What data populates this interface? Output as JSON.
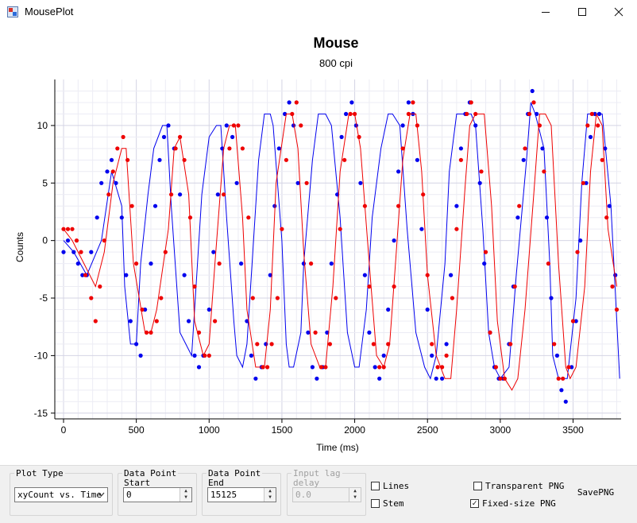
{
  "window": {
    "title": "MousePlot",
    "minimize_icon": "minimize-icon",
    "maximize_icon": "maximize-icon",
    "close_icon": "close-icon"
  },
  "colors": {
    "blue": "#0000ee",
    "red": "#ee0000",
    "grid": "#e4e4ee",
    "axis": "#000000"
  },
  "chart_data": {
    "type": "scatter",
    "title": "Mouse",
    "subtitle": "800 cpi",
    "xlabel": "Time (ms)",
    "ylabel": "Counts",
    "xlim": [
      -60,
      3830
    ],
    "ylim": [
      -15.5,
      14
    ],
    "xticks": [
      "0",
      "500",
      "1000",
      "1500",
      "2000",
      "2500",
      "3000",
      "3500"
    ],
    "yticks": [
      "10",
      "5",
      "0",
      "-5",
      "-10",
      "-15"
    ],
    "grid": true,
    "series": [
      {
        "color": "#0000ee",
        "curve_x": [
          0,
          70,
          160,
          260,
          330,
          400,
          420,
          460,
          500,
          530,
          580,
          620,
          680,
          710,
          740,
          800,
          880,
          900,
          950,
          1000,
          1050,
          1080,
          1120,
          1170,
          1190,
          1230,
          1260,
          1300,
          1340,
          1380,
          1420,
          1440,
          1500,
          1530,
          1550,
          1580,
          1630,
          1650,
          1710,
          1750,
          1800,
          1840,
          1900,
          1950,
          2000,
          2030,
          2080,
          2120,
          2180,
          2230,
          2260,
          2310,
          2360,
          2420,
          2480,
          2520,
          2560,
          2620,
          2650,
          2700,
          2750,
          2800,
          2830,
          2880,
          2920,
          2960,
          3000,
          3060,
          3110,
          3180,
          3210,
          3240,
          3300,
          3340,
          3360,
          3400,
          3460,
          3520,
          3560,
          3600,
          3630,
          3700,
          3760,
          3820
        ],
        "curve_y": [
          0,
          -1,
          -3,
          0,
          6,
          3,
          -4,
          -9,
          -9,
          -2,
          4,
          8,
          10,
          10,
          3,
          -8,
          -10,
          -6,
          4,
          9,
          10,
          10,
          2,
          -7,
          -10,
          -11,
          -9,
          -1,
          7,
          11,
          11,
          10,
          0,
          -9,
          -11,
          -11,
          -8,
          -2,
          7,
          11,
          11,
          10,
          2,
          -8,
          -11,
          -11,
          -6,
          2,
          8,
          11,
          11,
          10,
          1,
          -8,
          -11,
          -12,
          -10,
          -2,
          6,
          11,
          11,
          11,
          10,
          1,
          -8,
          -11,
          -12,
          -11,
          -3,
          7,
          12,
          11,
          8,
          -2,
          -10,
          -12,
          -12,
          -5,
          5,
          11,
          11,
          11,
          3,
          -12
        ],
        "points_x": [
          0,
          30,
          70,
          100,
          130,
          160,
          190,
          230,
          260,
          300,
          330,
          360,
          400,
          430,
          460,
          500,
          530,
          560,
          600,
          630,
          660,
          690,
          720,
          760,
          800,
          830,
          860,
          900,
          930,
          960,
          1000,
          1030,
          1060,
          1090,
          1120,
          1160,
          1190,
          1220,
          1260,
          1290,
          1320,
          1360,
          1390,
          1420,
          1450,
          1480,
          1520,
          1550,
          1580,
          1610,
          1650,
          1680,
          1710,
          1740,
          1780,
          1810,
          1840,
          1880,
          1910,
          1940,
          1980,
          2010,
          2040,
          2070,
          2100,
          2140,
          2170,
          2200,
          2230,
          2270,
          2300,
          2330,
          2370,
          2400,
          2430,
          2460,
          2500,
          2530,
          2560,
          2600,
          2630,
          2660,
          2700,
          2730,
          2760,
          2790,
          2830,
          2860,
          2890,
          2930,
          2960,
          2990,
          3020,
          3060,
          3090,
          3120,
          3160,
          3190,
          3220,
          3250,
          3290,
          3320,
          3350,
          3390,
          3420,
          3450,
          3490,
          3520,
          3550,
          3590,
          3620,
          3650,
          3680,
          3720,
          3750,
          3790
        ],
        "points_y": [
          -1,
          0,
          -1,
          -2,
          -3,
          -3,
          -1,
          2,
          5,
          6,
          7,
          5,
          2,
          -3,
          -7,
          -9,
          -10,
          -6,
          -2,
          3,
          7,
          9,
          10,
          8,
          4,
          -3,
          -7,
          -10,
          -11,
          -10,
          -6,
          -1,
          4,
          8,
          10,
          9,
          5,
          -2,
          -7,
          -10,
          -12,
          -11,
          -9,
          -3,
          3,
          8,
          11,
          12,
          10,
          5,
          -2,
          -8,
          -11,
          -12,
          -11,
          -8,
          -2,
          4,
          9,
          11,
          12,
          10,
          5,
          -3,
          -8,
          -11,
          -12,
          -10,
          -6,
          0,
          6,
          10,
          12,
          11,
          7,
          1,
          -6,
          -10,
          -12,
          -12,
          -9,
          -3,
          3,
          8,
          11,
          12,
          10,
          5,
          -2,
          -8,
          -11,
          -12,
          -12,
          -9,
          -4,
          2,
          7,
          11,
          13,
          11,
          8,
          2,
          -5,
          -10,
          -13,
          -14,
          -11,
          -7,
          0,
          5,
          9,
          11,
          11,
          8,
          3,
          -3,
          -8,
          -11,
          -12,
          -13
        ]
      },
      {
        "color": "#ee0000",
        "curve_x": [
          0,
          60,
          140,
          220,
          280,
          340,
          400,
          430,
          480,
          560,
          600,
          640,
          720,
          760,
          800,
          860,
          900,
          960,
          1000,
          1040,
          1100,
          1140,
          1180,
          1230,
          1260,
          1320,
          1380,
          1420,
          1460,
          1530,
          1570,
          1610,
          1650,
          1700,
          1760,
          1800,
          1850,
          1900,
          1960,
          2000,
          2040,
          2100,
          2150,
          2200,
          2240,
          2280,
          2330,
          2380,
          2420,
          2460,
          2500,
          2560,
          2620,
          2660,
          2700,
          2760,
          2790,
          2830,
          2890,
          2940,
          2980,
          3030,
          3080,
          3120,
          3170,
          3230,
          3270,
          3310,
          3350,
          3400,
          3450,
          3480,
          3520,
          3580,
          3620,
          3660,
          3700,
          3740,
          3800
        ],
        "curve_y": [
          1,
          0,
          -2,
          -4,
          -1,
          5,
          8,
          8,
          -2,
          -8,
          -8,
          -6,
          1,
          8,
          9,
          4,
          -7,
          -10,
          -9,
          -2,
          8,
          10,
          10,
          2,
          -6,
          -11,
          -11,
          -6,
          5,
          11,
          11,
          8,
          -1,
          -9,
          -11,
          -11,
          -4,
          6,
          11,
          11,
          8,
          -2,
          -10,
          -11,
          -9,
          -2,
          7,
          11,
          11,
          6,
          -3,
          -10,
          -12,
          -12,
          -6,
          5,
          10,
          11,
          11,
          3,
          -7,
          -12,
          -13,
          -12,
          -6,
          4,
          11,
          11,
          10,
          -2,
          -11,
          -12,
          -11,
          -4,
          6,
          11,
          10,
          1,
          -4
        ],
        "points_x": [
          0,
          30,
          60,
          90,
          120,
          150,
          190,
          220,
          250,
          280,
          310,
          340,
          370,
          410,
          440,
          470,
          500,
          540,
          570,
          600,
          640,
          670,
          700,
          740,
          770,
          800,
          830,
          870,
          900,
          930,
          970,
          1000,
          1040,
          1070,
          1100,
          1140,
          1170,
          1200,
          1230,
          1270,
          1300,
          1330,
          1370,
          1400,
          1430,
          1470,
          1500,
          1530,
          1570,
          1600,
          1630,
          1670,
          1700,
          1730,
          1770,
          1800,
          1830,
          1870,
          1900,
          1930,
          1970,
          2000,
          2030,
          2070,
          2100,
          2130,
          2170,
          2200,
          2230,
          2270,
          2300,
          2330,
          2370,
          2400,
          2430,
          2470,
          2500,
          2530,
          2570,
          2600,
          2630,
          2670,
          2700,
          2730,
          2770,
          2800,
          2830,
          2870,
          2900,
          2930,
          2970,
          3000,
          3030,
          3070,
          3100,
          3130,
          3170,
          3200,
          3230,
          3270,
          3300,
          3330,
          3370,
          3400,
          3430,
          3470,
          3500,
          3530,
          3570,
          3600,
          3630,
          3670,
          3700,
          3730,
          3770,
          3800
        ],
        "points_y": [
          1,
          1,
          1,
          0,
          -1,
          -3,
          -5,
          -7,
          -4,
          0,
          4,
          6,
          8,
          9,
          7,
          3,
          -2,
          -6,
          -8,
          -8,
          -7,
          -5,
          -1,
          4,
          8,
          9,
          7,
          2,
          -4,
          -8,
          -10,
          -10,
          -7,
          -2,
          4,
          8,
          10,
          10,
          8,
          2,
          -5,
          -9,
          -11,
          -11,
          -9,
          -5,
          1,
          7,
          11,
          12,
          10,
          5,
          -2,
          -8,
          -11,
          -11,
          -9,
          -5,
          1,
          7,
          11,
          11,
          9,
          3,
          -4,
          -9,
          -11,
          -11,
          -9,
          -4,
          3,
          8,
          11,
          12,
          10,
          4,
          -3,
          -9,
          -11,
          -11,
          -10,
          -5,
          1,
          7,
          11,
          12,
          11,
          6,
          -1,
          -8,
          -11,
          -12,
          -12,
          -9,
          -4,
          3,
          8,
          11,
          12,
          10,
          6,
          -2,
          -9,
          -12,
          -12,
          -11,
          -7,
          -1,
          5,
          10,
          11,
          10,
          7,
          2,
          -4,
          -6,
          -6,
          -5
        ]
      }
    ]
  },
  "controls": {
    "plot_type": {
      "label": "Plot Type",
      "value": "xyCount vs. Time"
    },
    "data_start": {
      "label": "Data Point\nStart",
      "value": "0"
    },
    "data_end": {
      "label": "Data Point\nEnd",
      "value": "15125"
    },
    "input_lag": {
      "label": "Input lag\ndelay",
      "value": "0.0"
    },
    "lines": {
      "label": "Lines",
      "checked": false
    },
    "stem": {
      "label": "Stem",
      "checked": false
    },
    "transparent_png": {
      "label": "Transparent PNG",
      "checked": false
    },
    "fixed_size_png": {
      "label": "Fixed-size PNG",
      "checked": true
    },
    "save_png": {
      "label": "SavePNG"
    },
    "checkmark": "✓"
  }
}
